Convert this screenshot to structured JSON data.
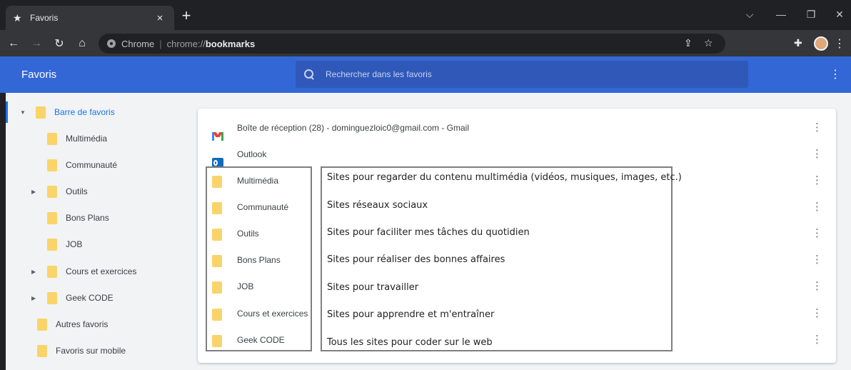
{
  "tab": {
    "title": "Favoris",
    "close": "×",
    "new_tab": "+"
  },
  "window_controls": {
    "dropdown": "⌵",
    "minimize": "—",
    "restore": "❐",
    "close": "✕"
  },
  "toolbar": {
    "back": "←",
    "forward": "→",
    "reload": "↻",
    "home": "⌂",
    "url_label": "Chrome",
    "url_separator": "|",
    "url_scheme": "chrome://",
    "url_host": "bookmarks",
    "share_icon": "⇪",
    "star_icon": "☆",
    "extensions_icon": "✚",
    "menu": "⋮"
  },
  "header": {
    "title": "Favoris",
    "search_placeholder": "Rechercher dans les favoris",
    "menu": "⋮"
  },
  "sidebar": {
    "items": [
      {
        "label": "Barre de favoris",
        "expanded": true
      },
      {
        "label": "Multimédia"
      },
      {
        "label": "Communauté"
      },
      {
        "label": "Outils",
        "expandable": true
      },
      {
        "label": "Bons Plans"
      },
      {
        "label": "JOB"
      },
      {
        "label": "Cours et exercices",
        "expandable": true
      },
      {
        "label": "Geek CODE",
        "expandable": true
      },
      {
        "label": "Autres favoris"
      },
      {
        "label": "Favoris sur mobile"
      }
    ],
    "arrow_down": "▼",
    "arrow_right": "▶"
  },
  "list": {
    "menu": "⋮",
    "rows": [
      {
        "title": "Boîte de réception (28) - dominguezloic0@gmail.com - Gmail",
        "icon": "gmail-icon"
      },
      {
        "title": "Outlook",
        "icon": "outlook-icon"
      },
      {
        "title": "Multimédia",
        "icon": "folder-icon"
      },
      {
        "title": "Communauté",
        "icon": "folder-icon"
      },
      {
        "title": "Outils",
        "icon": "folder-icon"
      },
      {
        "title": "Bons Plans",
        "icon": "folder-icon"
      },
      {
        "title": "JOB",
        "icon": "folder-icon"
      },
      {
        "title": "Cours et exercices",
        "icon": "folder-icon"
      },
      {
        "title": "Geek CODE",
        "icon": "folder-icon"
      }
    ]
  },
  "annotations": [
    "Sites pour regarder du contenu multimédia (vidéos, musiques, images, etc.)",
    "Sites réseaux sociaux",
    "Sites pour faciliter mes tâches du quotidien",
    "Sites pour réaliser des bonnes affaires",
    "Sites pour travailler",
    "Sites pour apprendre et m'entraîner",
    "Tous les sites pour coder sur le web"
  ],
  "colors": {
    "header": "#3367d6",
    "folder": "#f9d46a",
    "selected": "#1a73e8"
  }
}
